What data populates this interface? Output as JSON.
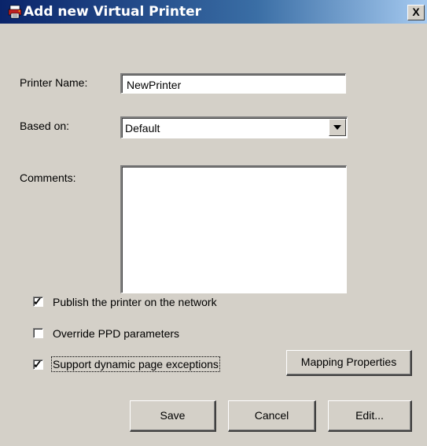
{
  "window": {
    "title": "Add new Virtual Printer",
    "close_label": "X"
  },
  "form": {
    "printer_name_label": "Printer Name:",
    "printer_name_value": "NewPrinter",
    "based_on_label": "Based on:",
    "based_on_value": "Default",
    "comments_label": "Comments:",
    "comments_value": ""
  },
  "options": [
    {
      "label": "Publish the printer on the network",
      "checked": true
    },
    {
      "label": "Override PPD parameters",
      "checked": false
    },
    {
      "label": "Support dynamic page exceptions",
      "checked": true
    }
  ],
  "buttons": {
    "mapping": "Mapping Properties",
    "save": "Save",
    "cancel": "Cancel",
    "edit": "Edit..."
  },
  "colors": {
    "title_start": "#0a246a",
    "title_end": "#a6caf0",
    "face": "#d4d0c8"
  },
  "icons": {
    "title_icon": "printer-app-icon",
    "check_mark": "check-icon",
    "dropdown_arrow": "chevron-down-icon"
  }
}
